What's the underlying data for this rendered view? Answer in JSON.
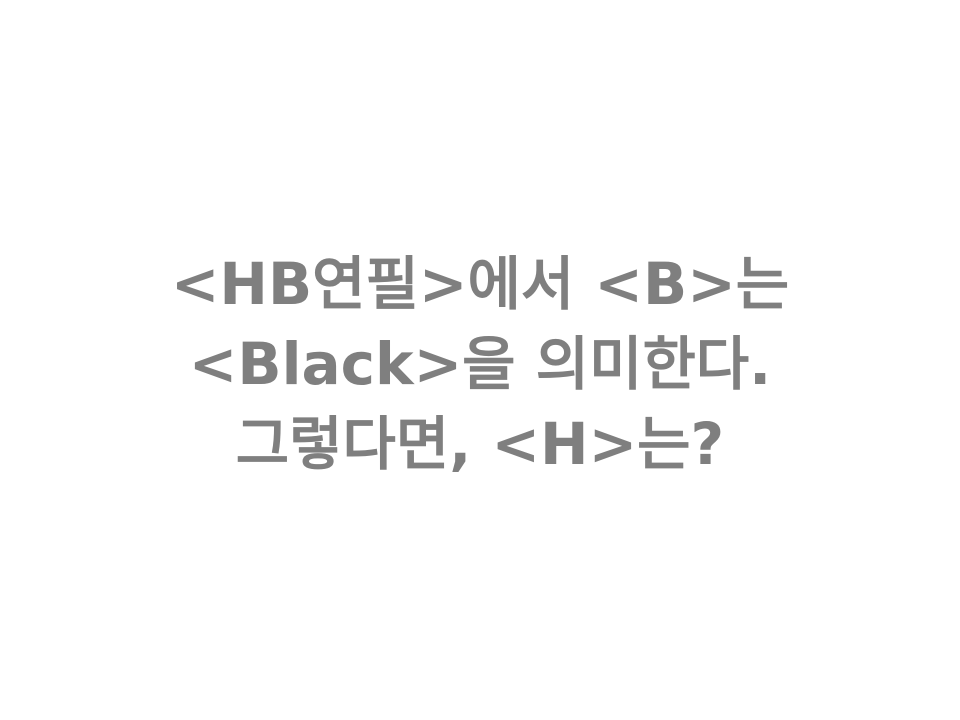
{
  "quiz": {
    "lines": [
      "<HB연필>에서 <B>는",
      "<Black>을 의미한다.",
      "그렇다면, <H>는?"
    ]
  }
}
